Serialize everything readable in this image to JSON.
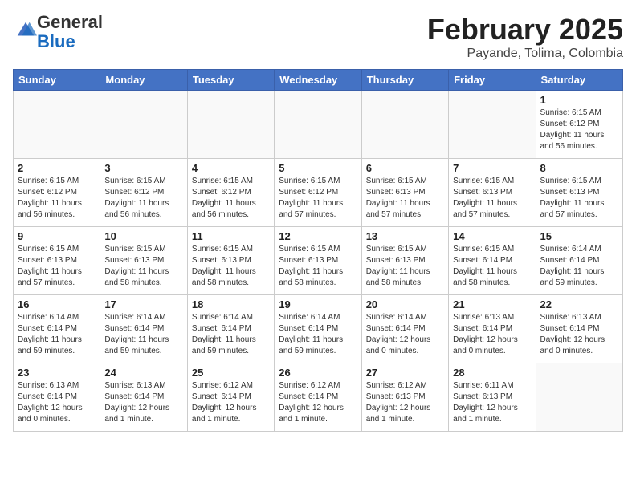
{
  "header": {
    "logo_general": "General",
    "logo_blue": "Blue",
    "month_title": "February 2025",
    "location": "Payande, Tolima, Colombia"
  },
  "weekdays": [
    "Sunday",
    "Monday",
    "Tuesday",
    "Wednesday",
    "Thursday",
    "Friday",
    "Saturday"
  ],
  "weeks": [
    [
      {
        "day": "",
        "info": ""
      },
      {
        "day": "",
        "info": ""
      },
      {
        "day": "",
        "info": ""
      },
      {
        "day": "",
        "info": ""
      },
      {
        "day": "",
        "info": ""
      },
      {
        "day": "",
        "info": ""
      },
      {
        "day": "1",
        "info": "Sunrise: 6:15 AM\nSunset: 6:12 PM\nDaylight: 11 hours and 56 minutes."
      }
    ],
    [
      {
        "day": "2",
        "info": "Sunrise: 6:15 AM\nSunset: 6:12 PM\nDaylight: 11 hours and 56 minutes."
      },
      {
        "day": "3",
        "info": "Sunrise: 6:15 AM\nSunset: 6:12 PM\nDaylight: 11 hours and 56 minutes."
      },
      {
        "day": "4",
        "info": "Sunrise: 6:15 AM\nSunset: 6:12 PM\nDaylight: 11 hours and 56 minutes."
      },
      {
        "day": "5",
        "info": "Sunrise: 6:15 AM\nSunset: 6:12 PM\nDaylight: 11 hours and 57 minutes."
      },
      {
        "day": "6",
        "info": "Sunrise: 6:15 AM\nSunset: 6:13 PM\nDaylight: 11 hours and 57 minutes."
      },
      {
        "day": "7",
        "info": "Sunrise: 6:15 AM\nSunset: 6:13 PM\nDaylight: 11 hours and 57 minutes."
      },
      {
        "day": "8",
        "info": "Sunrise: 6:15 AM\nSunset: 6:13 PM\nDaylight: 11 hours and 57 minutes."
      }
    ],
    [
      {
        "day": "9",
        "info": "Sunrise: 6:15 AM\nSunset: 6:13 PM\nDaylight: 11 hours and 57 minutes."
      },
      {
        "day": "10",
        "info": "Sunrise: 6:15 AM\nSunset: 6:13 PM\nDaylight: 11 hours and 58 minutes."
      },
      {
        "day": "11",
        "info": "Sunrise: 6:15 AM\nSunset: 6:13 PM\nDaylight: 11 hours and 58 minutes."
      },
      {
        "day": "12",
        "info": "Sunrise: 6:15 AM\nSunset: 6:13 PM\nDaylight: 11 hours and 58 minutes."
      },
      {
        "day": "13",
        "info": "Sunrise: 6:15 AM\nSunset: 6:13 PM\nDaylight: 11 hours and 58 minutes."
      },
      {
        "day": "14",
        "info": "Sunrise: 6:15 AM\nSunset: 6:14 PM\nDaylight: 11 hours and 58 minutes."
      },
      {
        "day": "15",
        "info": "Sunrise: 6:14 AM\nSunset: 6:14 PM\nDaylight: 11 hours and 59 minutes."
      }
    ],
    [
      {
        "day": "16",
        "info": "Sunrise: 6:14 AM\nSunset: 6:14 PM\nDaylight: 11 hours and 59 minutes."
      },
      {
        "day": "17",
        "info": "Sunrise: 6:14 AM\nSunset: 6:14 PM\nDaylight: 11 hours and 59 minutes."
      },
      {
        "day": "18",
        "info": "Sunrise: 6:14 AM\nSunset: 6:14 PM\nDaylight: 11 hours and 59 minutes."
      },
      {
        "day": "19",
        "info": "Sunrise: 6:14 AM\nSunset: 6:14 PM\nDaylight: 11 hours and 59 minutes."
      },
      {
        "day": "20",
        "info": "Sunrise: 6:14 AM\nSunset: 6:14 PM\nDaylight: 12 hours and 0 minutes."
      },
      {
        "day": "21",
        "info": "Sunrise: 6:13 AM\nSunset: 6:14 PM\nDaylight: 12 hours and 0 minutes."
      },
      {
        "day": "22",
        "info": "Sunrise: 6:13 AM\nSunset: 6:14 PM\nDaylight: 12 hours and 0 minutes."
      }
    ],
    [
      {
        "day": "23",
        "info": "Sunrise: 6:13 AM\nSunset: 6:14 PM\nDaylight: 12 hours and 0 minutes."
      },
      {
        "day": "24",
        "info": "Sunrise: 6:13 AM\nSunset: 6:14 PM\nDaylight: 12 hours and 1 minute."
      },
      {
        "day": "25",
        "info": "Sunrise: 6:12 AM\nSunset: 6:14 PM\nDaylight: 12 hours and 1 minute."
      },
      {
        "day": "26",
        "info": "Sunrise: 6:12 AM\nSunset: 6:14 PM\nDaylight: 12 hours and 1 minute."
      },
      {
        "day": "27",
        "info": "Sunrise: 6:12 AM\nSunset: 6:13 PM\nDaylight: 12 hours and 1 minute."
      },
      {
        "day": "28",
        "info": "Sunrise: 6:11 AM\nSunset: 6:13 PM\nDaylight: 12 hours and 1 minute."
      },
      {
        "day": "",
        "info": ""
      }
    ]
  ]
}
